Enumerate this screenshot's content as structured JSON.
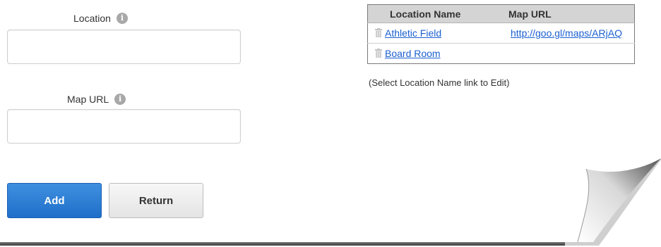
{
  "form": {
    "location_label": "Location",
    "location_value": "",
    "map_url_label": "Map URL",
    "map_url_value": "",
    "info_glyph": "i",
    "add_label": "Add",
    "return_label": "Return"
  },
  "table": {
    "headers": [
      "Location Name",
      "Map URL"
    ],
    "rows": [
      {
        "name": "Athletic Field",
        "url": "http://goo.gl/maps/ARjAQ"
      },
      {
        "name": "Board Room",
        "url": ""
      }
    ],
    "hint": "(Select Location Name link to Edit)"
  },
  "icons": {
    "info": "info-icon",
    "delete": "trash-icon",
    "decoration": "page-curl"
  },
  "colors": {
    "primary_button": "#2a7ad4",
    "link": "#1a5fd0",
    "table_header": "#d4d4d4"
  }
}
